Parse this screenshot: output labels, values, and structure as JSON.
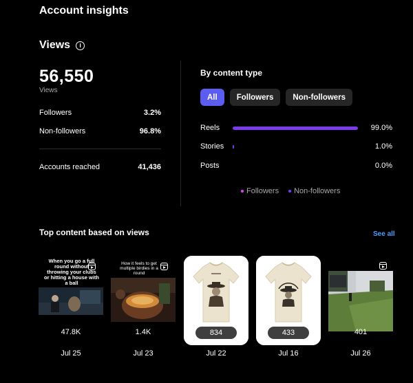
{
  "header": {
    "title": "Account insights"
  },
  "views": {
    "label": "Views",
    "info_icon": "i",
    "total": "56,550",
    "total_label": "Views",
    "rows": [
      {
        "label": "Followers",
        "value": "3.2%"
      },
      {
        "label": "Non-followers",
        "value": "96.8%"
      }
    ],
    "accounts_reached": {
      "label": "Accounts reached",
      "value": "41,436"
    }
  },
  "content_type": {
    "title": "By content type",
    "chips": [
      "All",
      "Followers",
      "Non-followers"
    ],
    "active_chip": "All",
    "rows": [
      {
        "label": "Reels",
        "value": "99.0%",
        "fraction": 0.99
      },
      {
        "label": "Stories",
        "value": "1.0%",
        "fraction": 0.01
      },
      {
        "label": "Posts",
        "value": "0.0%",
        "fraction": 0.0
      }
    ],
    "legend": [
      {
        "label": "Followers",
        "color": "#d946ef"
      },
      {
        "label": "Non-followers",
        "color": "#7c3aed"
      }
    ],
    "bar_color": "#7c3aed"
  },
  "top_content": {
    "title": "Top content based on views",
    "see_all": "See all",
    "items": [
      {
        "count": "47.8K",
        "date": "Jul 25",
        "caption": "When you go a full round without throwing your clubs or hitting a house with a ball"
      },
      {
        "count": "1.4K",
        "date": "Jul 23",
        "caption": "How it feels to get multiple birdies in a round"
      },
      {
        "count": "834",
        "date": "Jul 22",
        "shirt_text": ""
      },
      {
        "count": "433",
        "date": "Jul 16",
        "shirt_text": "OAK & IRON GOLF"
      },
      {
        "count": "401",
        "date": "Jul 26"
      }
    ]
  }
}
